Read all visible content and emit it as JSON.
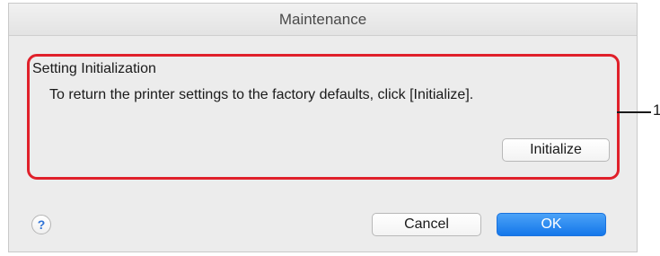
{
  "window": {
    "title": "Maintenance"
  },
  "setting_group": {
    "heading": "Setting Initialization",
    "description": "To return the printer settings to the factory defaults, click [Initialize].",
    "initialize_label": "Initialize"
  },
  "footer": {
    "help_icon": "question-mark-icon",
    "help_glyph": "?",
    "cancel_label": "Cancel",
    "ok_label": "OK"
  },
  "callout": {
    "number": "1"
  },
  "colors": {
    "highlight": "#e0202a",
    "default_button": "#1477ea"
  }
}
